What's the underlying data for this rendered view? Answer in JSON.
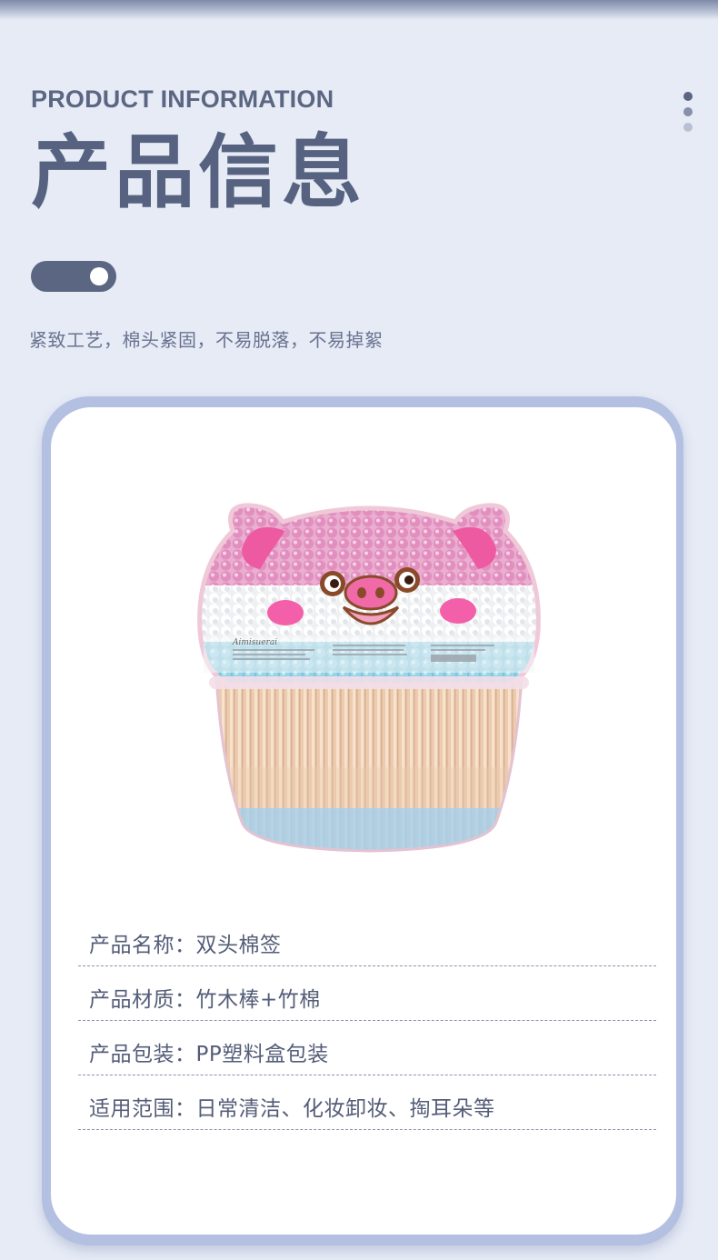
{
  "header": {
    "en_title": "PRODUCT INFORMATION",
    "cn_title": "产品信息",
    "subtitle": "紧致工艺，棉头紧固，不易脱落，不易掉絮"
  },
  "product": {
    "label_text": "Aimisuerai"
  },
  "info": [
    {
      "text": "产品名称：双头棉签"
    },
    {
      "text": "产品材质：竹木棒+竹棉"
    },
    {
      "text": "产品包装：PP塑料盒包装"
    },
    {
      "text": "适用范围：日常清洁、化妆卸妆、掏耳朵等"
    }
  ],
  "colors": {
    "background": "#e6ebf6",
    "accent": "#5b6683",
    "card_border": "#b4c0e2",
    "pink_cotton": "#e8a6c6",
    "blue_cotton": "#8fcbe0"
  }
}
